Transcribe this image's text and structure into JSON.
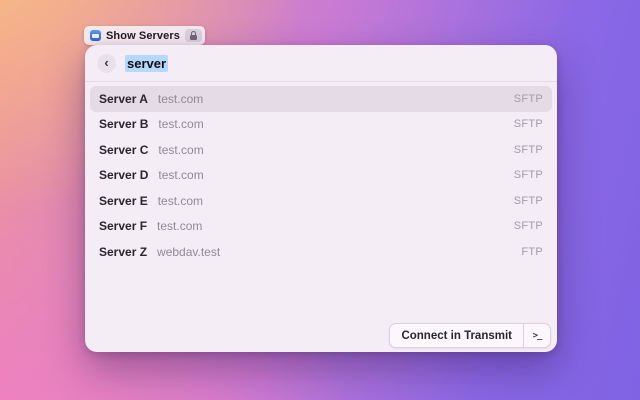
{
  "token": {
    "label": "Show Servers",
    "app_icon": "transmit-app-icon",
    "badge_icon": "lock-icon"
  },
  "search": {
    "back_glyph": "‹",
    "value": "server",
    "selection_color": "#b5d8fc"
  },
  "servers": [
    {
      "name": "Server A",
      "host": "test.com",
      "protocol": "SFTP",
      "selected": true
    },
    {
      "name": "Server B",
      "host": "test.com",
      "protocol": "SFTP",
      "selected": false
    },
    {
      "name": "Server C",
      "host": "test.com",
      "protocol": "SFTP",
      "selected": false
    },
    {
      "name": "Server D",
      "host": "test.com",
      "protocol": "SFTP",
      "selected": false
    },
    {
      "name": "Server E",
      "host": "test.com",
      "protocol": "SFTP",
      "selected": false
    },
    {
      "name": "Server F",
      "host": "test.com",
      "protocol": "SFTP",
      "selected": false
    },
    {
      "name": "Server Z",
      "host": "webdav.test",
      "protocol": "FTP",
      "selected": false
    }
  ],
  "footer": {
    "primary_label": "Connect in Transmit",
    "terminal_glyph": ">_"
  },
  "colors": {
    "window_bg": "#f4edf6",
    "selected_row_bg": "#e4dbe7",
    "gradient": [
      "#f7bd83",
      "#f0949b",
      "#f07fc5",
      "#8b68e6",
      "#7f63e2"
    ]
  }
}
